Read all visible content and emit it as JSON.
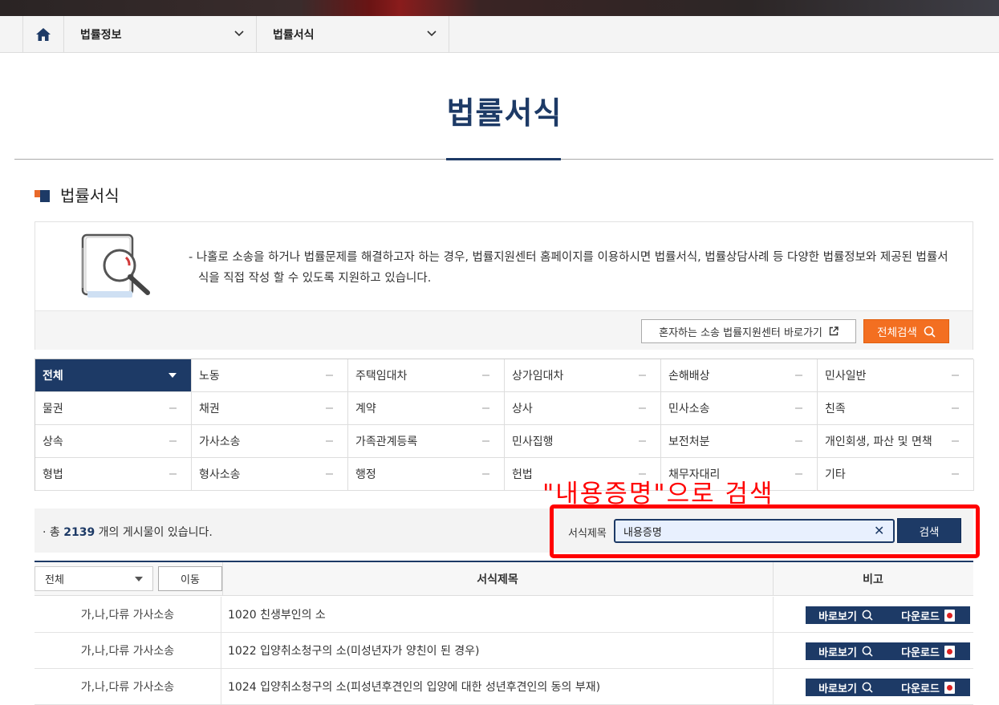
{
  "nav": {
    "home_icon": "home-icon",
    "menu1": "법률정보",
    "menu2": "법률서식"
  },
  "page": {
    "title": "법률서식",
    "section_title": "법률서식"
  },
  "info": {
    "description": "- 나홀로 소송을 하거나 법률문제를 해결하고자 하는 경우, 법률지원센터 홈페이지를 이용하시면 법률서식, 법률상담사례 등 다양한 법률정보와 제공된 법률서식을 직접 작성 할 수 있도록 지원하고 있습니다.",
    "link_button": "혼자하는 소송 법률지원센터 바로가기",
    "search_all_button": "전체검색"
  },
  "categories": [
    "전체",
    "노동",
    "주택임대차",
    "상가임대차",
    "손해배상",
    "민사일반",
    "물권",
    "채권",
    "계약",
    "상사",
    "민사소송",
    "친족",
    "상속",
    "가사소송",
    "가족관계등록",
    "민사집행",
    "보전처분",
    "개인회생, 파산 및 면책",
    "형법",
    "형사소송",
    "행정",
    "헌법",
    "채무자대리",
    "기타"
  ],
  "active_category": "전체",
  "search": {
    "count_prefix": "· 총 ",
    "count": "2139",
    "count_suffix": " 개의 게시물이 있습니다.",
    "field_label": "서식제목",
    "input_value": "내용증명",
    "button": "검색"
  },
  "annotation": "\"내용증명\"으로 검색",
  "table": {
    "select_value": "전체",
    "move_button": "이동",
    "col_title": "서식제목",
    "col_note": "비고",
    "view_label": "바로보기",
    "download_label": "다운로드",
    "rows": [
      {
        "category": "가,나,다류 가사소송",
        "title": "1020 친생부인의 소"
      },
      {
        "category": "가,나,다류 가사소송",
        "title": "1022 입양취소청구의 소(미성년자가 양친이 된 경우)"
      },
      {
        "category": "가,나,다류 가사소송",
        "title": "1024 입양취소청구의 소(피성년후견인의 입양에 대한 성년후견인의 동의 부재)"
      }
    ]
  },
  "colors": {
    "navy": "#1d3a66",
    "orange": "#f36f21",
    "annotation_red": "#ff0000"
  }
}
